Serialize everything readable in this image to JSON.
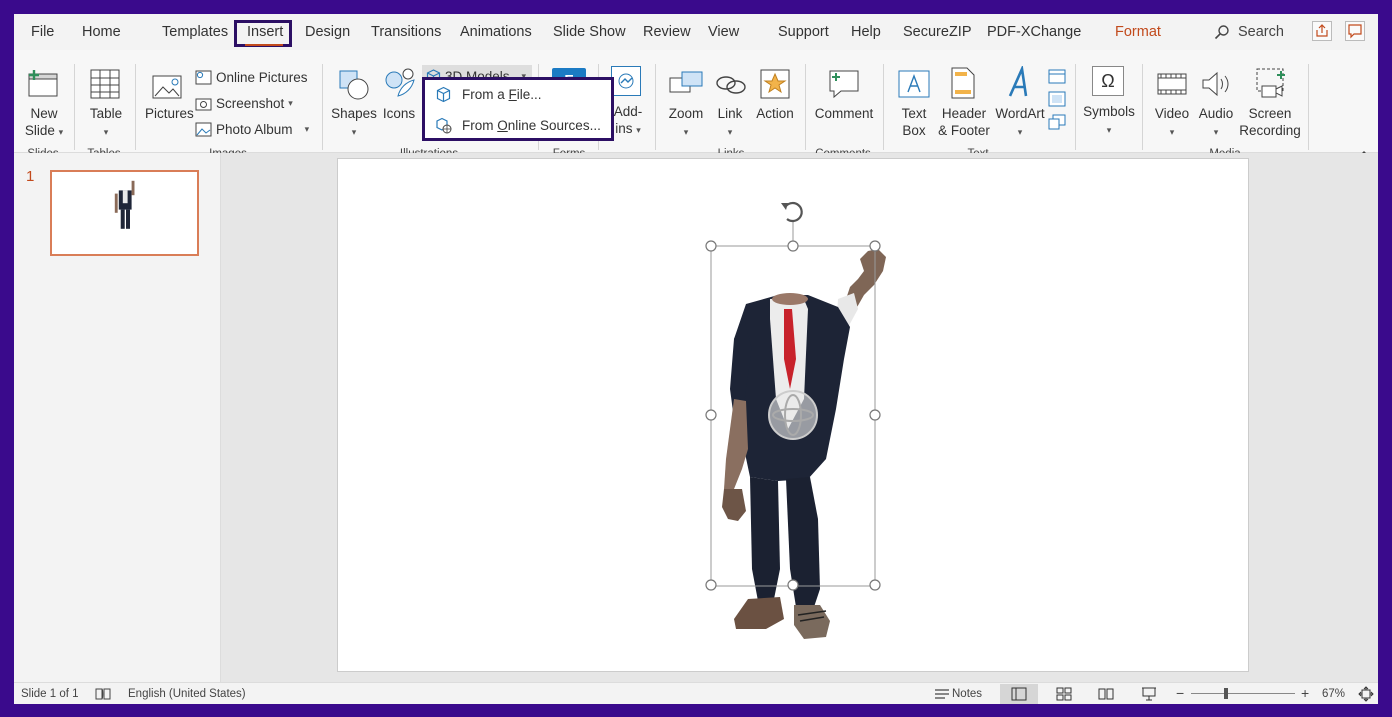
{
  "menu": {
    "tabs": [
      "File",
      "Home",
      "Templates",
      "Insert",
      "Design",
      "Transitions",
      "Animations",
      "Slide Show",
      "Review",
      "View",
      "Support",
      "Help",
      "SecureZIP",
      "PDF-XChange",
      "Format"
    ],
    "active_tab": "Insert",
    "search_label": "Search"
  },
  "ribbon": {
    "groups": {
      "slides": "Slides",
      "tables": "Tables",
      "images": "Images",
      "illustrations": "Illustrations",
      "forms": "Forms",
      "links": "Links",
      "comments": "Comments",
      "text": "Text",
      "media": "Media"
    },
    "new_slide": [
      "New",
      "Slide"
    ],
    "table": "Table",
    "pictures": "Pictures",
    "online_pictures": "Online Pictures",
    "screenshot": "Screenshot",
    "photo_album": "Photo Album",
    "shapes": "Shapes",
    "icons": "Icons",
    "models_3d": "3D Models",
    "addins": [
      "Add-",
      "ins"
    ],
    "zoom": "Zoom",
    "link": "Link",
    "action": "Action",
    "comment": "Comment",
    "text_box": [
      "Text",
      "Box"
    ],
    "header_footer": [
      "Header",
      "& Footer"
    ],
    "wordart": "WordArt",
    "symbols": "Symbols",
    "video": "Video",
    "audio": "Audio",
    "screen_recording": [
      "Screen",
      "Recording"
    ]
  },
  "dropdown_3d": {
    "items": [
      {
        "pre": "From a ",
        "key": "F",
        "post": "ile..."
      },
      {
        "pre": "From ",
        "key": "O",
        "post": "nline Sources..."
      }
    ]
  },
  "thumbnails": {
    "slide_number": "1"
  },
  "status": {
    "slide_info": "Slide 1 of 1",
    "language": "English (United States)",
    "notes": "Notes",
    "zoom": "67%"
  },
  "colors": {
    "accent": "#c24a1c",
    "highlight_frame": "#2c0f64",
    "background_frame": "#3a0a8c"
  }
}
